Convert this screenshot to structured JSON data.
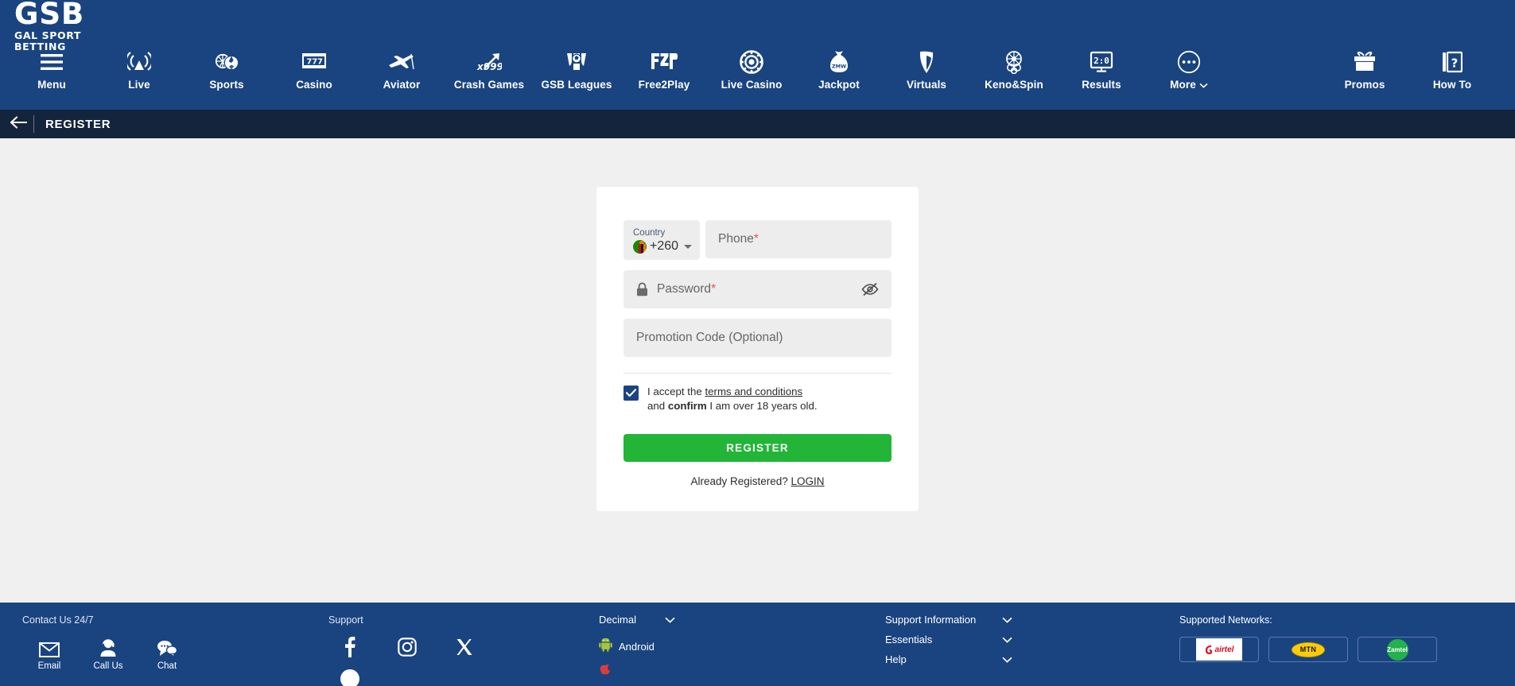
{
  "brand": {
    "logo_main": "GSB",
    "logo_sub": "GAL SPORT BETTING",
    "nav_blue": "#1a4480",
    "title_navy": "#14243c",
    "accent_green": "#22b538",
    "page_bg": "#f0f0f0"
  },
  "topnav": {
    "items": [
      {
        "label": "Menu",
        "icon": "hamburger-menu-icon"
      },
      {
        "label": "Live",
        "icon": "live-broadcast-icon"
      },
      {
        "label": "Sports",
        "icon": "sports-balls-icon"
      },
      {
        "label": "Casino",
        "icon": "slot-machine-777-icon"
      },
      {
        "label": "Aviator",
        "icon": "airplane-icon"
      },
      {
        "label": "Crash Games",
        "icon": "x999-arrow-icon"
      },
      {
        "label": "GSB Leagues",
        "icon": "trophy-football-icon"
      },
      {
        "label": "Free2Play",
        "icon": "f2p-icon"
      },
      {
        "label": "Live Casino",
        "icon": "roulette-chip-icon"
      },
      {
        "label": "Jackpot",
        "icon": "money-bag-zmw-icon"
      },
      {
        "label": "Virtuals",
        "icon": "virtuals-v-icon"
      },
      {
        "label": "Keno&Spin",
        "icon": "keno-wheel-icon"
      },
      {
        "label": "Results",
        "icon": "scoreboard-2-0-icon"
      },
      {
        "label": "More",
        "icon": "more-dots-icon",
        "has_chevron": true
      }
    ],
    "right_items": [
      {
        "label": "Promos",
        "icon": "gift-box-icon"
      },
      {
        "label": "How To",
        "icon": "book-question-icon"
      }
    ]
  },
  "titlebar": {
    "back_icon": "arrow-left-icon",
    "title": "REGISTER"
  },
  "form": {
    "country_label": "Country",
    "country_flag": "zambia-flag-icon",
    "country_code": "+260",
    "phone_placeholder": "Phone",
    "phone_required_mark": "*",
    "phone_value": "",
    "password_placeholder": "Password",
    "password_required_mark": "*",
    "password_value": "",
    "password_icon": "lock-icon",
    "password_toggle_icon": "eye-off-icon",
    "promo_placeholder": "Promotion Code (Optional)",
    "promo_value": "",
    "terms_checked": true,
    "terms_prefix": "I accept the ",
    "terms_link": "terms and conditions",
    "terms_line2_a": "and ",
    "terms_line2_bold": "confirm",
    "terms_line2_b": " I am over 18 years old.",
    "register_label": "REGISTER",
    "already_text": "Already Registered? ",
    "login_link": "LOGIN"
  },
  "footer": {
    "contact": {
      "heading": "Contact Us 24/7",
      "items": [
        {
          "label": "Email",
          "icon": "envelope-icon"
        },
        {
          "label": "Call Us",
          "icon": "support-agent-icon"
        },
        {
          "label": "Chat",
          "icon": "chat-bubbles-icon"
        }
      ]
    },
    "social": {
      "heading": "Support",
      "items": [
        {
          "icon": "facebook-icon"
        },
        {
          "icon": "instagram-icon"
        },
        {
          "icon": "x-twitter-icon"
        }
      ],
      "items_row2": [
        {
          "icon": "tiktok-icon"
        }
      ]
    },
    "odds": {
      "selected": "Decimal",
      "chevron": "chevron-down-icon",
      "apps": [
        {
          "label": "Android",
          "icon": "android-icon"
        },
        {
          "label": "",
          "icon": "ios-icon"
        }
      ]
    },
    "links": [
      {
        "label": "Support Information",
        "chevron": "chevron-down-icon"
      },
      {
        "label": "Essentials",
        "chevron": "chevron-down-icon"
      },
      {
        "label": "Help",
        "chevron": "chevron-down-icon"
      }
    ],
    "networks": {
      "heading": "Supported Networks:",
      "items": [
        {
          "name": "airtel"
        },
        {
          "name": "MTN"
        },
        {
          "name": "Zamtel"
        }
      ]
    }
  }
}
